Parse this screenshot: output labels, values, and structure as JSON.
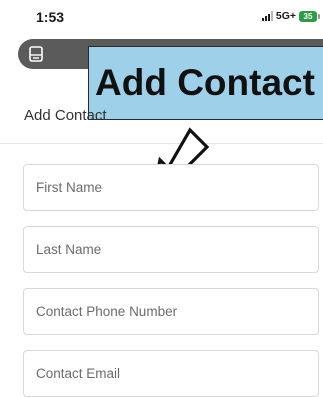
{
  "status_bar": {
    "time": "1:53",
    "network": "5G+",
    "battery": "35"
  },
  "browser": {
    "tabs_icon": "tabs-icon",
    "close_icon": "close-icon"
  },
  "callout": {
    "text": "Add Contact"
  },
  "page": {
    "heading": "Add Contact"
  },
  "form": {
    "first_name_placeholder": "First Name",
    "last_name_placeholder": "Last Name",
    "phone_placeholder": "Contact Phone Number",
    "email_placeholder": "Contact Email"
  },
  "colors": {
    "callout_bg": "#9fd0ea",
    "battery": "#2e9b47",
    "url_bar": "#5b5b5b"
  }
}
